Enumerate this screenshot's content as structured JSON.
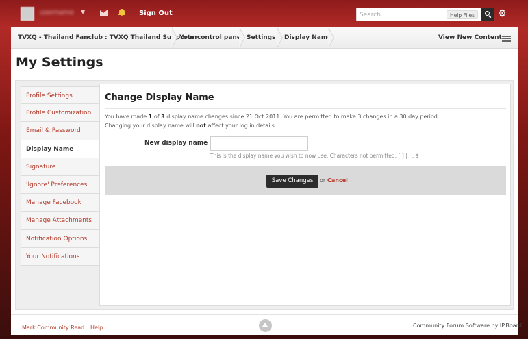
{
  "topbar": {
    "username": "username",
    "sign_out": "Sign Out",
    "search_placeholder": "Search...",
    "help_files": "Help Files"
  },
  "breadcrumb": {
    "items": [
      "TVXQ - Thailand Fanclub : TVXQ Thailand Supporter",
      "Your control panel",
      "Settings",
      "Display Name"
    ],
    "view_new_content": "View New Content"
  },
  "page_title": "My Settings",
  "sidebar": {
    "items": [
      {
        "label": "Profile Settings",
        "active": false
      },
      {
        "label": "Profile Customization",
        "active": false
      },
      {
        "label": "Email & Password",
        "active": false
      },
      {
        "label": "Display Name",
        "active": true
      },
      {
        "label": "Signature",
        "active": false
      },
      {
        "label": "'Ignore' Preferences",
        "active": false
      },
      {
        "label": "Manage Facebook",
        "active": false
      },
      {
        "label": "Manage Attachments",
        "active": false
      },
      {
        "label": "Notification Options",
        "active": false
      },
      {
        "label": "Your Notifications",
        "active": false
      }
    ]
  },
  "form": {
    "title": "Change Display Name",
    "info_prefix": "You have made ",
    "changes_made": "1",
    "info_of": " of ",
    "changes_total": "3",
    "info_suffix": " display name changes since 21 Oct 2011. You are permitted to make 3 changes in a 30 day period.",
    "note_prefix": "Changing your display name will ",
    "note_emph": "not",
    "note_suffix": " affect your log in details.",
    "field_label": "New display name",
    "field_value": "",
    "field_help": "This is the display name you wish to now use. Characters not permitted: [ ] | , ; $",
    "save_label": "Save Changes",
    "or_label": "or",
    "cancel_label": "Cancel"
  },
  "footer": {
    "mark_read": "Mark Community Read",
    "help": "Help",
    "powered_by": "Community Forum Software by IP.Board"
  },
  "colors": {
    "header_red": "#b12a27",
    "link_red": "#b53a2a",
    "button_dark": "#2c2c2c"
  }
}
